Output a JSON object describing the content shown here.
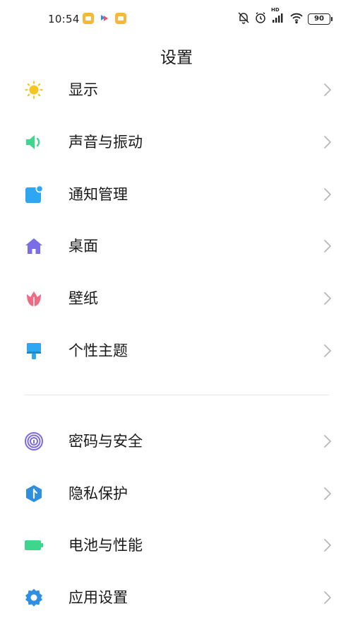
{
  "status_bar": {
    "time": "10:54",
    "battery": "90",
    "network": "HD"
  },
  "header": {
    "title": "设置"
  },
  "groups": [
    {
      "items": [
        {
          "label": "显示",
          "icon": "sun-icon",
          "color": "#F5C523"
        },
        {
          "label": "声音与振动",
          "icon": "speaker-icon",
          "color": "#3DD68C"
        },
        {
          "label": "通知管理",
          "icon": "notification-icon",
          "color": "#2EA6F2"
        },
        {
          "label": "桌面",
          "icon": "home-icon",
          "color": "#7B6CE8"
        },
        {
          "label": "壁纸",
          "icon": "tulip-icon",
          "color": "#F06A86"
        },
        {
          "label": "个性主题",
          "icon": "brush-icon",
          "color": "#2EA6F2"
        }
      ]
    },
    {
      "items": [
        {
          "label": "密码与安全",
          "icon": "fingerprint-icon",
          "color": "#7B6CE8"
        },
        {
          "label": "隐私保护",
          "icon": "privacy-shield-icon",
          "color": "#2E8FE0"
        },
        {
          "label": "电池与性能",
          "icon": "battery-icon",
          "color": "#3DD68C"
        },
        {
          "label": "应用设置",
          "icon": "gear-icon",
          "color": "#2E8FE0"
        }
      ]
    }
  ]
}
